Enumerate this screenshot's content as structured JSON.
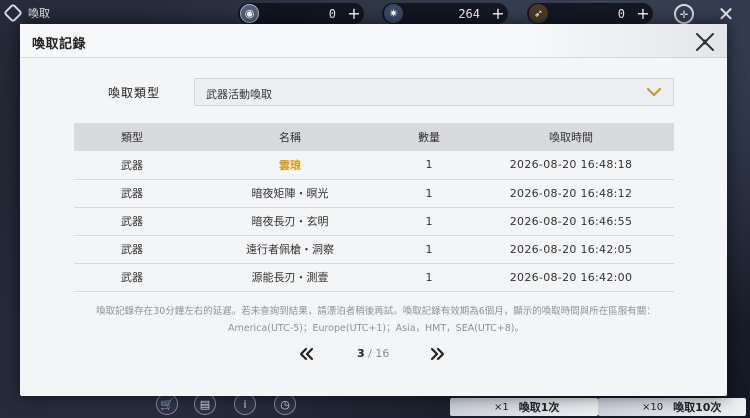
{
  "hud": {
    "back_label": "喚取",
    "currencies": [
      {
        "icon": "crystal-coin-icon",
        "amount": "0"
      },
      {
        "icon": "star-crystal-icon",
        "amount": "264"
      },
      {
        "icon": "feather-ticket-icon",
        "amount": "0"
      }
    ],
    "bottom": {
      "pull_once": {
        "count": "×1",
        "label": "喚取1次"
      },
      "pull_ten": {
        "count": "×10",
        "label": "喚取10次"
      }
    }
  },
  "dialog": {
    "title": "喚取記錄",
    "filter": {
      "label": "喚取類型",
      "selected": "武器活動喚取"
    },
    "table": {
      "headers": [
        "類型",
        "名稱",
        "數量",
        "喚取時間"
      ],
      "rows": [
        {
          "type": "武器",
          "name": "雲琅",
          "qty": "1",
          "time": "2026-08-20 16:48:18",
          "highlight": true
        },
        {
          "type": "武器",
          "name": "暗夜矩陣・暝光",
          "qty": "1",
          "time": "2026-08-20 16:48:12",
          "highlight": false
        },
        {
          "type": "武器",
          "name": "暗夜長刃・玄明",
          "qty": "1",
          "time": "2026-08-20 16:46:55",
          "highlight": false
        },
        {
          "type": "武器",
          "name": "遠行者佩槍・洞察",
          "qty": "1",
          "time": "2026-08-20 16:42:05",
          "highlight": false
        },
        {
          "type": "武器",
          "name": "源能長刃・測壹",
          "qty": "1",
          "time": "2026-08-20 16:42:00",
          "highlight": false
        }
      ]
    },
    "notice_line1": "喚取記錄存在30分鐘左右的延遲。若未查詢到結果，請漂泊者稍後再試。喚取記錄有效期為6個月，顯示的喚取時間與所在區服有關：",
    "notice_line2": "America(UTC-5)；Europe(UTC+1)；Asia，HMT，SEA(UTC+8)。",
    "pager": {
      "current": "3",
      "separator": "/",
      "total": "16"
    }
  },
  "colors": {
    "highlight_gold": "#d49a16",
    "header_bg": "#d8dade",
    "dialog_bg": "#f4f5f7"
  }
}
